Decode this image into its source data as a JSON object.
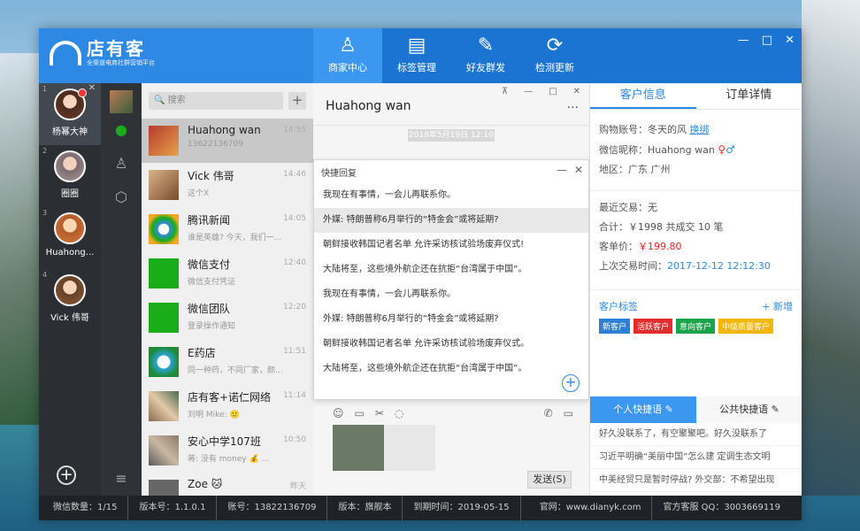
{
  "app": {
    "logo_title": "店有客",
    "logo_sub": "全渠道电商社群营销平台"
  },
  "nav": [
    {
      "label": "商家中心",
      "icon": "person-icon"
    },
    {
      "label": "标签管理",
      "icon": "tag-doc-icon"
    },
    {
      "label": "好友群发",
      "icon": "broadcast-icon"
    },
    {
      "label": "检测更新",
      "icon": "refresh-icon"
    }
  ],
  "accounts": [
    {
      "num": "1",
      "name": "杨幂大神"
    },
    {
      "num": "2",
      "name": "圈圈"
    },
    {
      "num": "3",
      "name": "Huahong..."
    },
    {
      "num": "4",
      "name": "Vick 伟哥"
    }
  ],
  "search": {
    "placeholder": "搜索"
  },
  "conversations": [
    {
      "name": "Huahong wan",
      "msg": "13622136709",
      "time": "14:55"
    },
    {
      "name": "Vick 伟哥",
      "msg": "这个X",
      "time": "14:46"
    },
    {
      "name": "腾讯新闻",
      "msg": "谁是英雄? 今天，我们一...",
      "time": "14:05"
    },
    {
      "name": "微信支付",
      "msg": "微信支付凭证",
      "time": "12:40"
    },
    {
      "name": "微信团队",
      "msg": "登录操作通知",
      "time": "12:20"
    },
    {
      "name": "E药店",
      "msg": "同一种药，不同厂家，颜...",
      "time": "11:51"
    },
    {
      "name": "店有客+诺仁网络",
      "msg": "刘明 Mike: 🙂",
      "time": "11:14"
    },
    {
      "name": "安心中学107班",
      "msg": "蒋: 没有 money 💰 ...",
      "time": "10:50"
    },
    {
      "name": "Zoe 🐱",
      "msg": "",
      "time": "昨天"
    }
  ],
  "chat": {
    "title": "Huahong wan",
    "date": "2018年5月19日 12:10",
    "send_label": "发送(S)"
  },
  "quick_reply": {
    "title": "快捷回复",
    "items": [
      "我现在有事情，一会儿再联系你。",
      "外媒: 特朗普称6月举行的“特金会”或将延期?",
      "朝鲜接收韩国记者名单 允许采访核试验场废弃仪式!",
      "大陆将至，这些境外航企还在抗拒“台湾属于中国”。",
      "我现在有事情，一会儿再联系你。",
      "外媒: 特朗普称6月举行的“特金会”或将延期?",
      "朝鲜接收韩国记者名单 允许采访核试验场废弃仪式。",
      "大陆将至，这些境外航企还在抗拒“台湾属于中国”。"
    ]
  },
  "info": {
    "tab_customer": "客户信息",
    "tab_order": "订单详情",
    "shop_account_label": "购物账号：冬天的风",
    "unbind": "换绑",
    "wechat_label": "微信昵称：Huahong wan",
    "region": "地区：广东 广州",
    "recent": "最近交易：无",
    "total": "合计：￥1998 共成交 10 笔",
    "unit_label": "客单价：",
    "unit_value": "￥199.80",
    "last_label": "上次交易时间：",
    "last_value": "2017-12-12 12:12:30",
    "tags_title": "客户标签",
    "tags_add": "+ 新增",
    "tags": [
      {
        "text": "新客户",
        "color": "#2e7fd6"
      },
      {
        "text": "活跃客户",
        "color": "#e02d2d"
      },
      {
        "text": "意向客户",
        "color": "#1aa34a"
      },
      {
        "text": "中级质量客户",
        "color": "#f2b705"
      }
    ],
    "qtab_personal": "个人快捷语",
    "qtab_public": "公共快捷语",
    "phrases": [
      "好久没联系了，有空聚聚吧。好久没联系了",
      "习近平明确“美丽中国”怎么建 定调生态文明",
      "中美经贸只是暂时停战? 外交部：不希望出现"
    ]
  },
  "status": {
    "wechat_count": "微信数量：1/15",
    "version": "版本号：1.1.0.1",
    "account": "账号：13822136709",
    "edition": "版本：旗舰本",
    "expire": "到期时间：2019-05-15",
    "site": "官网：www.dianyk.com",
    "qq": "官方客服 QQ：3003669119"
  },
  "colors": {
    "primary": "#2e89e5",
    "nav_dark": "#1c74d2",
    "sidebar": "#2b2f33"
  }
}
